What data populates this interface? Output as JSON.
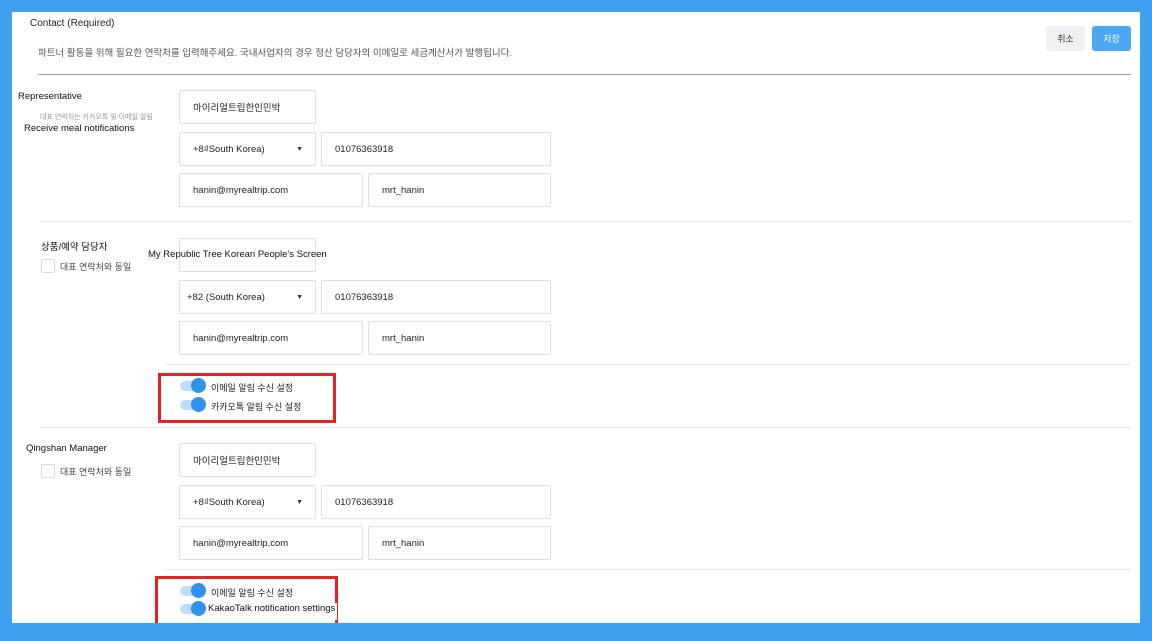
{
  "header": {
    "title": "Contact (Required)",
    "description": "파트너 활동을 위해 필요한 연락처를 입력해주세요. 국내사업자의 경우 정산 담당자의 이메일로 세금계산서가 발행됩니다.",
    "cancel_label": "취소",
    "save_label": "저장"
  },
  "representative": {
    "label": "Representative",
    "sub_text": "대표 연락처는 카카오톡 및 이메일 알림",
    "overlay_text": "Receive meal notifications",
    "name": "마이리얼트립한인민박",
    "country_code": "+8₫South Korea)",
    "phone": "01076363918",
    "email": "hanin@myrealtrip.com",
    "id": "mrt_hanin"
  },
  "product_manager": {
    "label": "상품/예약 담당자",
    "same_as_rep_label": "대표 연락처와 동일",
    "name_overlay": "My Republic Tree Korean People's Screen",
    "country_code": "+82 (South Korea)",
    "phone": "01076363918",
    "email": "hanin@myrealtrip.com",
    "id": "mrt_hanin",
    "email_toggle_label": "이메일 알림 수신 설정",
    "kakao_toggle_label": "카카오톡 알림 수신 설정",
    "email_toggle_on": true,
    "kakao_toggle_on": true
  },
  "qingshan_manager": {
    "label": "Qingshan Manager",
    "same_as_rep_label": "대표 연락처와 동일",
    "name": "마이리얼트립한인민박",
    "country_code": "+8₫South Korea)",
    "phone": "01076363918",
    "email": "hanin@myrealtrip.com",
    "id": "mrt_hanin",
    "email_toggle_label": "이메일 알림 수신 설정",
    "kakao_toggle_label": "KakaoTalk notification settings",
    "email_toggle_on": true,
    "kakao_toggle_on": true
  },
  "colors": {
    "frame": "#3ea0ef",
    "accent": "#2f93ee",
    "highlight_box": "#e52222"
  },
  "icons": {
    "dropdown": "caret-down-icon"
  }
}
